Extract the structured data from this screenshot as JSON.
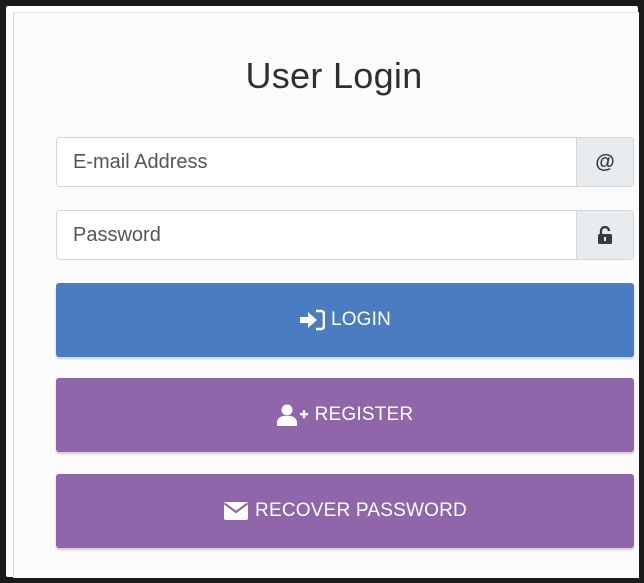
{
  "colors": {
    "login": "#4a7cc2",
    "register": "#8f66aa",
    "recover": "#8f66aa"
  },
  "form": {
    "title": "User Login",
    "email": {
      "placeholder": "E-mail Address",
      "value": "",
      "addon_icon": "at-sign-icon",
      "addon_text": "@"
    },
    "password": {
      "placeholder": "Password",
      "value": "",
      "addon_icon": "unlock-icon"
    }
  },
  "buttons": {
    "login": {
      "label": "LOGIN",
      "icon": "sign-in-icon"
    },
    "register": {
      "label": "REGISTER",
      "icon": "user-plus-icon"
    },
    "recover": {
      "label": "RECOVER PASSWORD",
      "icon": "envelope-icon"
    }
  }
}
